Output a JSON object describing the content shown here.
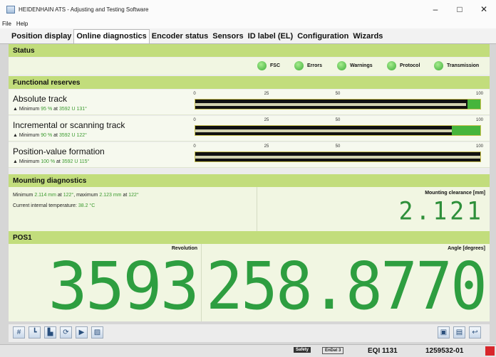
{
  "window": {
    "title": "HEIDENHAIN ATS - Adjusting and Testing Software",
    "minimize": "–",
    "maximize": "□",
    "close": "✕"
  },
  "menu": {
    "file": "File",
    "help": "Help"
  },
  "tabs": [
    "Position display",
    "Online diagnostics",
    "Encoder status",
    "Sensors",
    "ID label (EL)",
    "Configuration",
    "Wizards"
  ],
  "active_tab": "Online diagnostics",
  "status": {
    "header": "Status",
    "indicators": [
      {
        "label": "FSC",
        "color": "#3fae3a"
      },
      {
        "label": "Errors",
        "color": "#3fae3a"
      },
      {
        "label": "Warnings",
        "color": "#3fae3a"
      },
      {
        "label": "Protocol",
        "color": "#3fae3a"
      },
      {
        "label": "Transmission",
        "color": "#3fae3a"
      }
    ]
  },
  "reserves": {
    "header": "Functional reserves",
    "scale_ticks": [
      "0",
      "25",
      "50",
      "100"
    ],
    "rows": [
      {
        "name": "Absolute track",
        "min_prefix": "Minimum",
        "min_value": "95 %",
        "at": "at",
        "pos": "3592 U 131°",
        "fraction": 0.95
      },
      {
        "name": "Incremental or scanning track",
        "min_prefix": "Minimum",
        "min_value": "90 %",
        "at": "at",
        "pos": "3592 U 122°",
        "fraction": 0.9
      },
      {
        "name": "Position-value formation",
        "min_prefix": "Minimum",
        "min_value": "100 %",
        "at": "at",
        "pos": "3592 U 115°",
        "fraction": 1.0
      }
    ]
  },
  "mounting": {
    "header": "Mounting diagnostics",
    "line1_a": "Minimum",
    "line1_min": "2.114 mm",
    "line1_b": "at",
    "line1_min_angle": "122°",
    "line1_c": ", maximum",
    "line1_max": "2.123 mm",
    "line1_d": "at",
    "line1_max_angle": "122°",
    "line2_a": "Current internal temperature:",
    "line2_temp": "38.2 °C",
    "clearance_label": "Mounting clearance [mm]",
    "clearance_value": "2.121"
  },
  "pos1": {
    "header": "POS1",
    "revolution_label": "Revolution",
    "revolution_value": "3593",
    "angle_label": "Angle [degrees]",
    "angle_value": "258.8770"
  },
  "statusbar": {
    "safety": "Safety",
    "endat": "EnDat 3",
    "device": "EQI 1131",
    "serial": "1259532-01"
  }
}
